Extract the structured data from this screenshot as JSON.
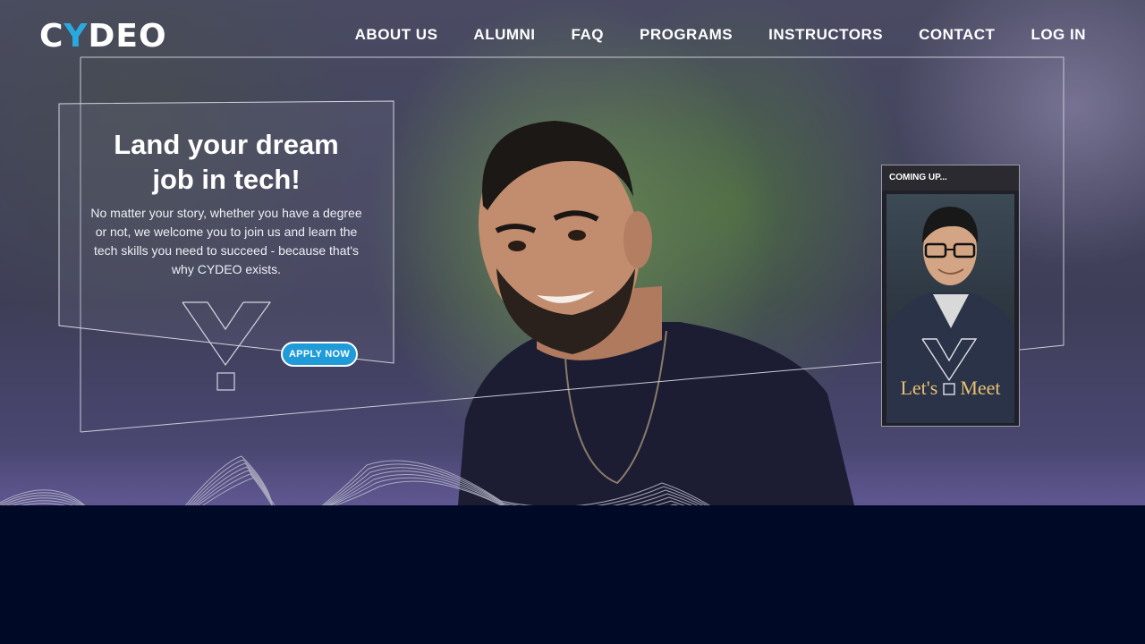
{
  "brand": {
    "logo_prefix": "C",
    "logo_y": "Y",
    "logo_suffix": "DEO",
    "accent": "#2aa9e0"
  },
  "nav": {
    "items": [
      "ABOUT US",
      "ALUMNI",
      "FAQ",
      "PROGRAMS",
      "INSTRUCTORS",
      "CONTACT",
      "LOG IN"
    ]
  },
  "hero": {
    "title_line1": "Land your dream",
    "title_line2": "job in tech!",
    "description": "No matter your story, whether you have a degree or not, we welcome you to join us and learn the tech skills you need to succeed - because that's why CYDEO exists.",
    "cta_label": "APPLY NOW",
    "cta_color": "#1e9bd8"
  },
  "coming_up": {
    "header": "COMING UP...",
    "video_text_left": "Let's",
    "video_text_right": "Meet",
    "text_color": "#e8c173"
  },
  "colors": {
    "footer_bg": "#000926",
    "hero_tint": "#4e4a7a"
  }
}
